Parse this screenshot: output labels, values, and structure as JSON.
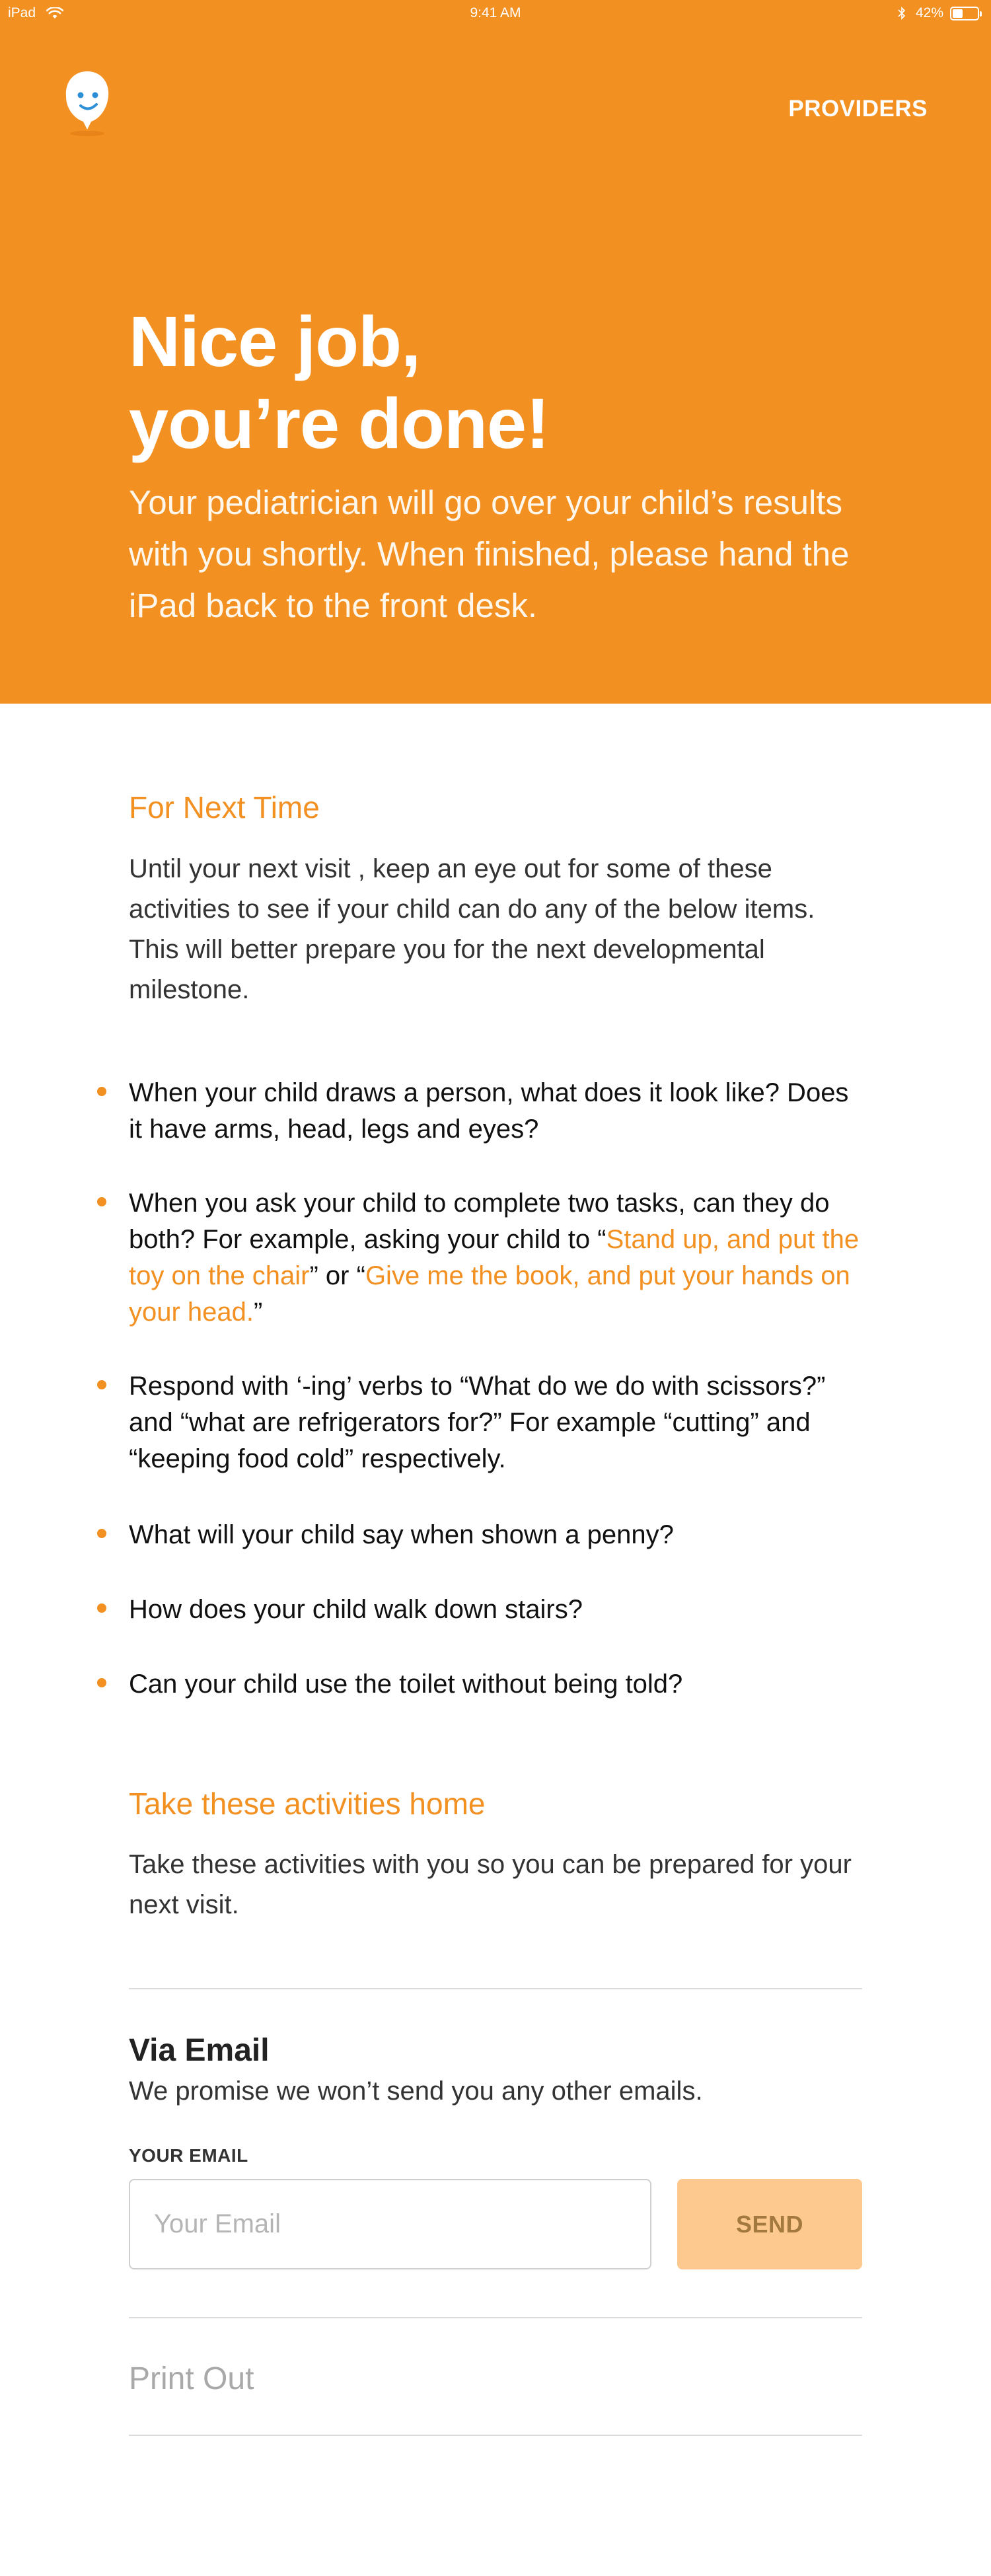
{
  "status_bar": {
    "device": "iPad",
    "time": "9:41 AM",
    "battery": "42%",
    "battery_level": 0.42
  },
  "header": {
    "providers_label": "PROVIDERS"
  },
  "hero": {
    "title_line1": "Nice job,",
    "title_line2": "you’re done!",
    "subtitle": "Your pediatrician will go over your child’s results with you shortly. When finished, please hand the iPad back to the front desk."
  },
  "next_time": {
    "heading": "For Next Time",
    "intro": "Until your next visit , keep an eye out for some of these activities to see if your child can do any of the below items. This will better prepare you for the next developmental milestone.",
    "items": [
      {
        "text": "When your child draws a person, what does it look like? Does it have arms, head, legs and eyes?"
      },
      {
        "text_before": "When you ask your child to complete two tasks, can they do both? For example, asking your child to “",
        "highlight1": "Stand up, and put the toy on the chair",
        "text_middle": "” or “",
        "highlight2": "Give me the book, and put your hands on your head.",
        "text_after": "”"
      },
      {
        "text": "Respond with ‘-ing’ verbs to “What do we do with scissors?” and “what are refrigerators for?” For example “cutting” and “keeping food cold” respectively."
      },
      {
        "text": "What will your child say when shown a penny?"
      },
      {
        "text": "How does your child walk down stairs?"
      },
      {
        "text": "Can your child use the toilet without being told?"
      }
    ]
  },
  "take_home": {
    "heading": "Take these activities home",
    "intro": "Take these activities with you so you can be prepared for your next visit."
  },
  "via_email": {
    "title": "Via Email",
    "subtitle": "We promise we won’t send you any other emails.",
    "label": "YOUR EMAIL",
    "placeholder": "Your Email",
    "value": "",
    "send_label": "SEND"
  },
  "print_out": {
    "label": "Print Out"
  },
  "colors": {
    "accent": "#f29021",
    "send_disabled_bg": "#fdc98e",
    "muted_text": "#a9a9a9",
    "divider": "#dcdcdc"
  }
}
